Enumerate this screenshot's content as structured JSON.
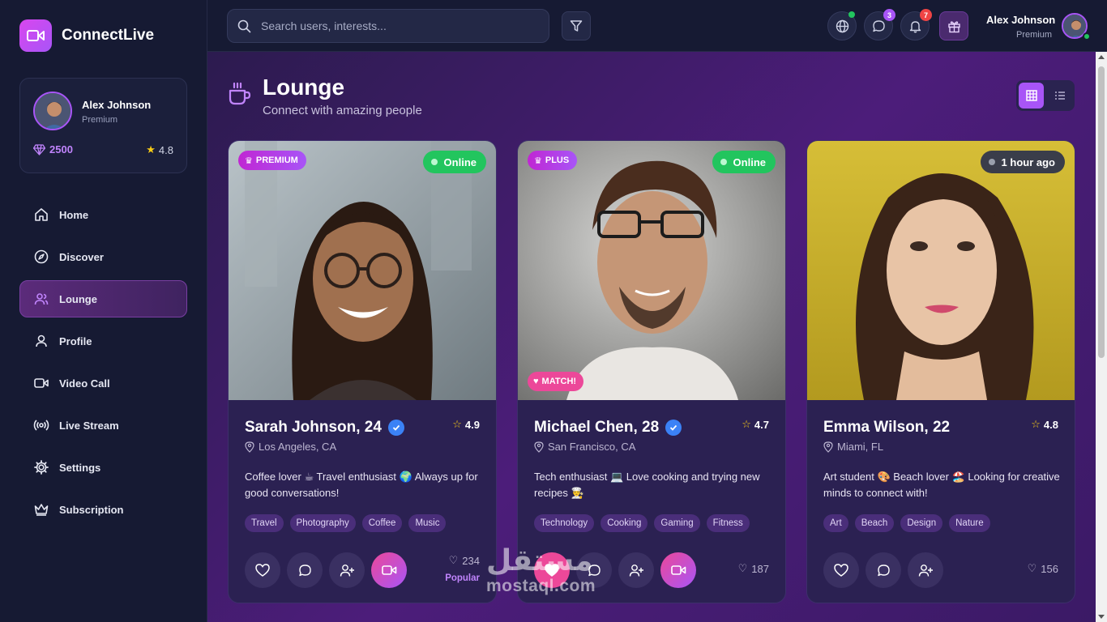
{
  "brand": {
    "name": "ConnectLive"
  },
  "user": {
    "name": "Alex Johnson",
    "tier": "Premium",
    "gems": "2500",
    "rating": "4.8"
  },
  "nav": [
    {
      "label": "Home",
      "icon": "home-icon"
    },
    {
      "label": "Discover",
      "icon": "compass-icon"
    },
    {
      "label": "Lounge",
      "icon": "users-icon",
      "active": true
    },
    {
      "label": "Profile",
      "icon": "user-icon"
    },
    {
      "label": "Video Call",
      "icon": "video-icon"
    },
    {
      "label": "Live Stream",
      "icon": "broadcast-icon"
    },
    {
      "label": "Settings",
      "icon": "gear-icon"
    },
    {
      "label": "Subscription",
      "icon": "crown-icon"
    }
  ],
  "search": {
    "placeholder": "Search users, interests..."
  },
  "topbar": {
    "messages_count": "3",
    "notifications_count": "7"
  },
  "page": {
    "title": "Lounge",
    "subtitle": "Connect with amazing people"
  },
  "colors": {
    "accent": "#a855f7",
    "online": "#22c55e",
    "like": "#ec4899",
    "verified": "#3b82f6"
  },
  "cards": [
    {
      "name": "Sarah Johnson, 24",
      "verified": true,
      "rating": "4.9",
      "location": "Los Angeles, CA",
      "tier": "PREMIUM",
      "status": "Online",
      "bio": "Coffee lover ☕ Travel enthusiast 🌍 Always up for good conversations!",
      "tags": [
        "Travel",
        "Photography",
        "Coffee",
        "Music"
      ],
      "likes": "234",
      "label": "Popular"
    },
    {
      "name": "Michael Chen, 28",
      "verified": true,
      "rating": "4.7",
      "location": "San Francisco, CA",
      "tier": "PLUS",
      "status": "Online",
      "match": "MATCH!",
      "bio": "Tech enthusiast 💻 Love cooking and trying new recipes 👨‍🍳",
      "tags": [
        "Technology",
        "Cooking",
        "Gaming",
        "Fitness"
      ],
      "likes": "187"
    },
    {
      "name": "Emma Wilson, 22",
      "verified": false,
      "rating": "4.8",
      "location": "Miami, FL",
      "status": "1 hour ago",
      "bio": "Art student 🎨 Beach lover 🏖️ Looking for creative minds to connect with!",
      "tags": [
        "Art",
        "Beach",
        "Design",
        "Nature"
      ],
      "likes": "156"
    }
  ],
  "watermark": {
    "arabic": "مستقل",
    "latin": "mostaql.com"
  }
}
